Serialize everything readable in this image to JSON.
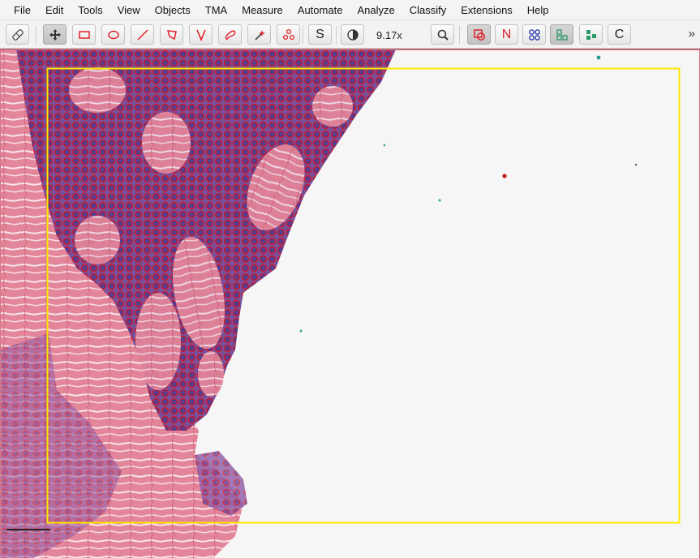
{
  "menu": [
    "File",
    "Edit",
    "Tools",
    "View",
    "Objects",
    "TMA",
    "Measure",
    "Automate",
    "Analyze",
    "Classify",
    "Extensions",
    "Help"
  ],
  "toolbar": {
    "zoom_level": "9.17x",
    "show_slide_label_letter": "S",
    "show_names_letter": "N",
    "show_class_letter": "C",
    "overflow": "»"
  },
  "colors": {
    "annotation_yellow": "#ffe800",
    "detection_red": "#d8141e",
    "tissue_pink": "#e0788f",
    "nucleus_purple": "#5a3f8a",
    "background_white": "#f6f6f6"
  },
  "viewer": {
    "annotation_type": "rectangle",
    "content": "H&E tissue with cell detections"
  }
}
